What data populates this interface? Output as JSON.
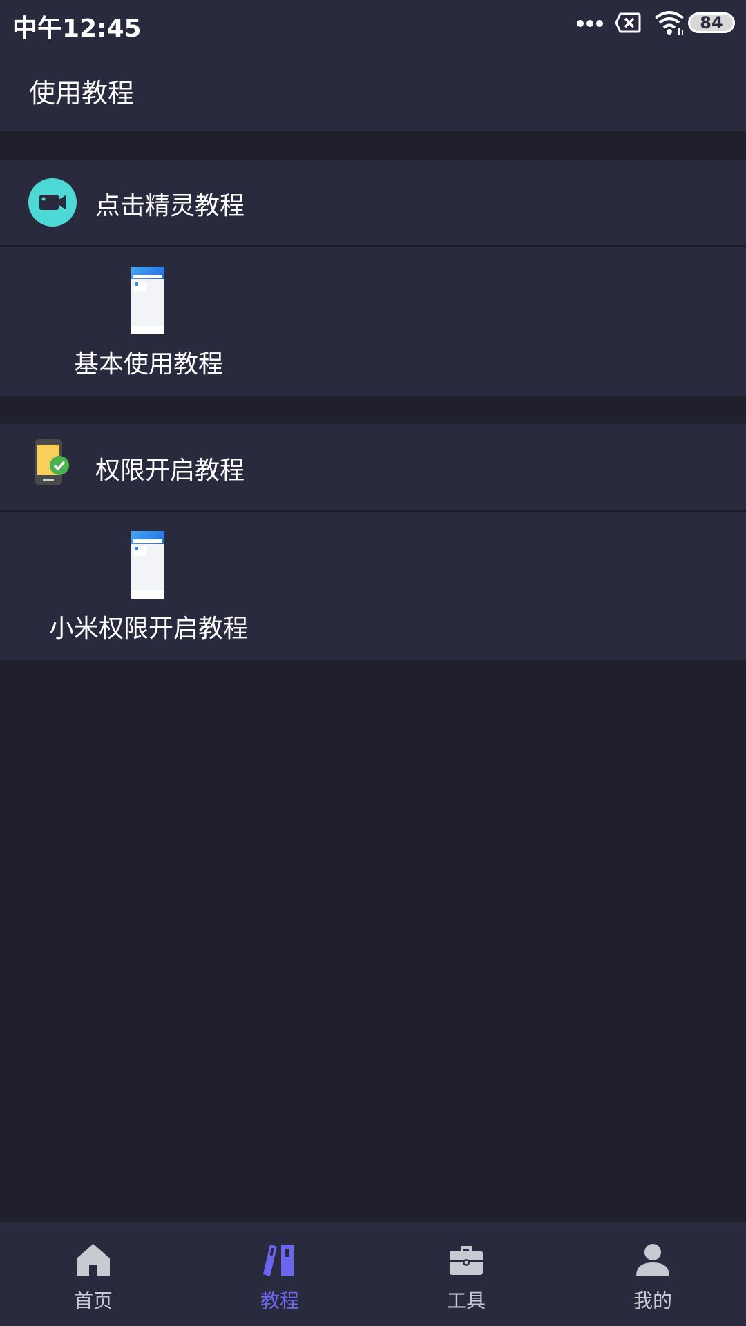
{
  "status_bar": {
    "time": "中午12:45",
    "battery": "84",
    "icons": [
      "more-dots-icon",
      "close-box-icon",
      "wifi-icon",
      "battery-icon"
    ]
  },
  "header": {
    "title": "使用教程"
  },
  "sections": [
    {
      "title": "点击精灵教程",
      "icon": "video-camera-icon",
      "icon_color": "#4ed9d7",
      "items": [
        {
          "label": "基本使用教程"
        }
      ]
    },
    {
      "title": "权限开启教程",
      "icon": "phone-check-icon",
      "icon_color": "#4caf50",
      "items": [
        {
          "label": "小米权限开启教程"
        }
      ]
    }
  ],
  "bottom_nav": {
    "active": "教程",
    "active_color": "#6a66f0",
    "tabs": [
      {
        "label": "首页",
        "icon": "home-icon"
      },
      {
        "label": "教程",
        "icon": "books-icon"
      },
      {
        "label": "工具",
        "icon": "toolbox-icon"
      },
      {
        "label": "我的",
        "icon": "user-icon"
      }
    ]
  }
}
